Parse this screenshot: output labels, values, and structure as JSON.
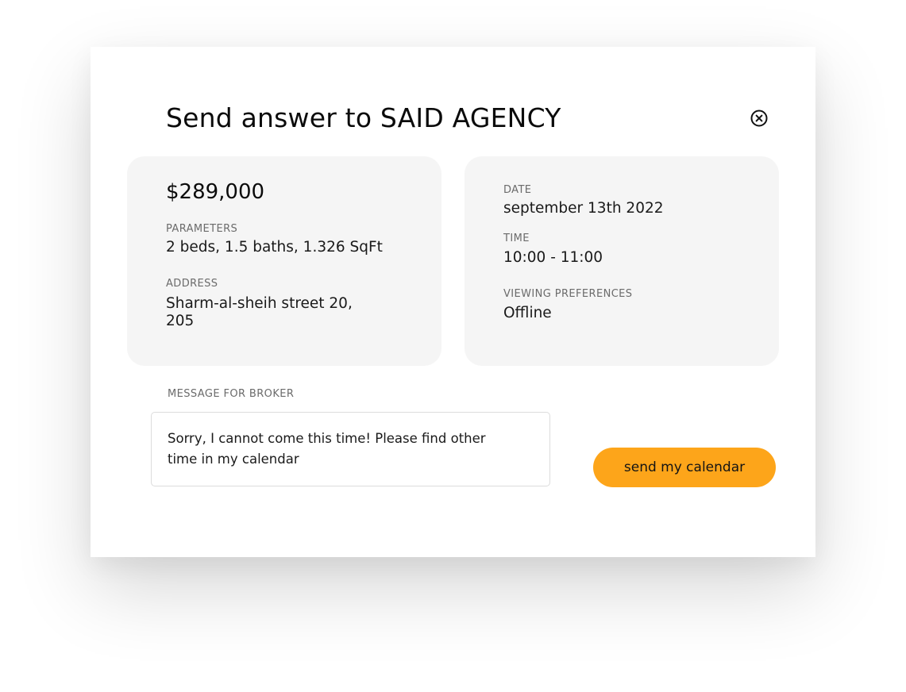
{
  "modal": {
    "title": "Send answer to SAID AGENCY"
  },
  "listing": {
    "price": "$289,000",
    "parameters_label": "PARAMETERS",
    "parameters_value": "2 beds, 1.5 baths, 1.326 SqFt",
    "address_label": "ADDRESS",
    "address_line1": "Sharm-al-sheih street 20,",
    "address_line2": "205"
  },
  "viewing": {
    "date_label": "DATE",
    "date_value": "september 13th 2022",
    "time_label": "TIME",
    "time_value": "10:00 - 11:00",
    "preferences_label": "VIEWING PREFERENCES",
    "preferences_value": "Offline"
  },
  "message": {
    "label": "MESSAGE FOR BROKER",
    "line1": "Sorry, I cannot come this time! Please find other",
    "line2": "time in my calendar"
  },
  "actions": {
    "send_label": "send my calendar"
  },
  "colors": {
    "accent": "#FDA51A",
    "card_bg": "#F5F5F5"
  },
  "icons": {
    "close": "close-circle-icon"
  }
}
